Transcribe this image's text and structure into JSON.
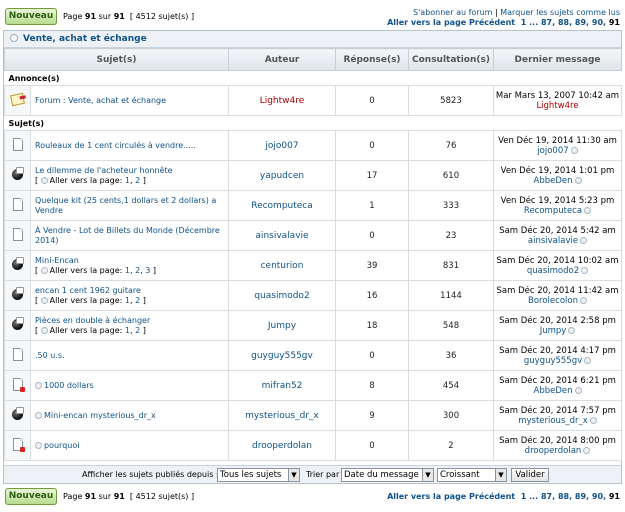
{
  "toolbar": {
    "new_label": "Nouveau",
    "page_prefix": "Page",
    "page_current": "91",
    "page_of": "sur",
    "page_total": "91",
    "topic_count": "[ 4512 sujet(s) ]",
    "subscribe_link": "S'abonner au forum",
    "separator": "|",
    "mark_read_link": "Marquer les sujets comme lus",
    "goto_label": "Aller vers la page",
    "prev_label": "Précédent",
    "pages": [
      "1",
      "...",
      "87,",
      "88,",
      "89,",
      "90,",
      "91"
    ]
  },
  "forum": {
    "title": "Vente, achat et échange"
  },
  "columns": [
    "Sujet(s)",
    "Auteur",
    "Réponse(s)",
    "Consultation(s)",
    "Dernier message"
  ],
  "announce_section": "Annonce(s)",
  "topics_section": "Sujet(s)",
  "announcement": {
    "icon": "announcement-icon",
    "title": "Forum : Vente, achat et échange",
    "author": "Lightw4re",
    "replies": "0",
    "views": "5823",
    "last_date": "Mar Mars 13, 2007 10:42 am",
    "last_user": "Lightw4re"
  },
  "topics": [
    {
      "icon": "topic-icon",
      "title": "Rouleaux de 1 cent circulés à vendre.....",
      "pages": [],
      "author": "jojo007",
      "replies": "0",
      "views": "76",
      "last_date": "Ven Déc 19, 2014 11:30 am",
      "last_user": "jojo007"
    },
    {
      "icon": "hot-topic-icon",
      "title": "Le dilemme de l'acheteur honnête",
      "pages": [
        "1",
        "2"
      ],
      "author": "yapudcen",
      "replies": "17",
      "views": "610",
      "last_date": "Ven Déc 19, 2014 1:01 pm",
      "last_user": "AbbeDen"
    },
    {
      "icon": "topic-icon",
      "title": "Quelque kit (25 cents,1 dollars et 2 dollars) a Vendre",
      "pages": [],
      "author": "Recomputeca",
      "replies": "1",
      "views": "333",
      "last_date": "Ven Déc 19, 2014 5:23 pm",
      "last_user": "Recomputeca"
    },
    {
      "icon": "topic-icon",
      "title": "À Vendre - Lot de Billets du Monde (Décembre 2014)",
      "pages": [],
      "author": "ainsivalavie",
      "replies": "0",
      "views": "23",
      "last_date": "Sam Déc 20, 2014 5:42 am",
      "last_user": "ainsivalavie"
    },
    {
      "icon": "hot-topic-icon",
      "title": "Mini-Encan",
      "pages": [
        "1",
        "2",
        "3"
      ],
      "author": "centurion",
      "replies": "39",
      "views": "831",
      "last_date": "Sam Déc 20, 2014 10:02 am",
      "last_user": "quasimodo2"
    },
    {
      "icon": "hot-topic-icon",
      "title": "encan 1 cent 1962 guitare",
      "pages": [
        "1",
        "2"
      ],
      "author": "quasimodo2",
      "replies": "16",
      "views": "1144",
      "last_date": "Sam Déc 20, 2014 11:42 am",
      "last_user": "Borolecolon"
    },
    {
      "icon": "hot-topic-icon",
      "title": "Pièces en double à échanger",
      "pages": [
        "1",
        "2"
      ],
      "author": "Jumpy",
      "replies": "18",
      "views": "548",
      "last_date": "Sam Déc 20, 2014 2:58 pm",
      "last_user": "Jumpy"
    },
    {
      "icon": "topic-icon",
      "title": ".50 u.s.",
      "pages": [],
      "author": "guyguy555gv",
      "replies": "0",
      "views": "36",
      "last_date": "Sam Déc 20, 2014 4:17 pm",
      "last_user": "guyguy555gv"
    },
    {
      "icon": "new-topic-icon",
      "title": "1000 dollars",
      "pages": [],
      "author": "mifran52",
      "replies": "8",
      "views": "454",
      "last_date": "Sam Déc 20, 2014 6:21 pm",
      "last_user": "AbbeDen"
    },
    {
      "icon": "hot-new-topic-icon",
      "title": "Mini-encan mysterious_dr_x",
      "pages": [],
      "author": "mysterious_dr_x",
      "replies": "9",
      "views": "300",
      "last_date": "Sam Déc 20, 2014 7:57 pm",
      "last_user": "mysterious_dr_x"
    },
    {
      "icon": "new-topic-icon",
      "title": "pourquoi",
      "pages": [],
      "author": "drooperdolan",
      "replies": "0",
      "views": "2",
      "last_date": "Sam Déc 20, 2014 8:00 pm",
      "last_user": "drooperdolan"
    }
  ],
  "pages_label": "Aller vers la page:",
  "filter": {
    "show_label": "Afficher les sujets publiés depuis :",
    "since_value": "Tous les sujets",
    "sort_label": "Trier par",
    "sort_value": "Date du message",
    "order_value": "Croissant",
    "submit_label": "Valider"
  }
}
